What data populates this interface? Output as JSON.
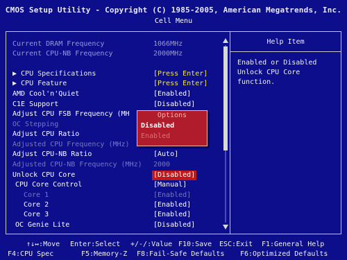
{
  "header": {
    "title": "CMOS Setup Utility - Copyright (C) 1985-2005, American Megatrends, Inc.",
    "subtitle": "Cell Menu"
  },
  "info": [
    {
      "label": "Current DRAM Frequency",
      "value": "1066MHz"
    },
    {
      "label": "Current CPU-NB Frequency",
      "value": "2000MHz"
    }
  ],
  "menu": [
    {
      "label": "▶ CPU Specifications",
      "value": "[Press Enter]"
    },
    {
      "label": "▶ CPU Feature",
      "value": "[Press Enter]"
    },
    {
      "label": "AMD Cool'n'Quiet",
      "value": "[Enabled]"
    },
    {
      "label": "C1E Support",
      "value": "[Disabled]"
    },
    {
      "label": "Adjust CPU FSB Frequency (MH",
      "value": ""
    },
    {
      "label": "OC Stepping",
      "value": ""
    },
    {
      "label": "Adjust CPU Ratio",
      "value": ""
    },
    {
      "label": "Adjusted CPU Frequency (MHz)",
      "value": ""
    },
    {
      "label": "Adjust CPU-NB Ratio",
      "value": "[Auto]"
    },
    {
      "label": "Adjusted CPU-NB Frequency (MHz)",
      "value": "2000"
    },
    {
      "label": "Unlock CPU Core",
      "value": "[Disabled]"
    },
    {
      "label": "CPU Core Control",
      "value": "[Manual]"
    },
    {
      "label": "Core 1",
      "value": "[Enabled]"
    },
    {
      "label": "Core 2",
      "value": "[Enabled]"
    },
    {
      "label": "Core 3",
      "value": "[Enabled]"
    },
    {
      "label": "OC Genie Lite",
      "value": "[Disabled]"
    }
  ],
  "help": {
    "title": "Help Item",
    "text": "Enabled or Disabled Unlock CPU Core function."
  },
  "popup": {
    "title": "Options",
    "options": [
      "Disabled",
      "Enabled"
    ]
  },
  "footer": {
    "line1": [
      "↑↓↔:Move",
      "Enter:Select",
      "+/-/:Value",
      "F10:Save",
      "ESC:Exit",
      "F1:General Help"
    ],
    "line2": [
      "F4:CPU Spec",
      "F5:Memory-Z",
      "F8:Fail-Safe Defaults",
      "F6:Optimized Defaults"
    ]
  },
  "colors": {
    "background": "#0c0e8c",
    "value_yellow": "#f5e64a",
    "selection_red": "#c01818",
    "popup_red": "#b01c2c"
  }
}
